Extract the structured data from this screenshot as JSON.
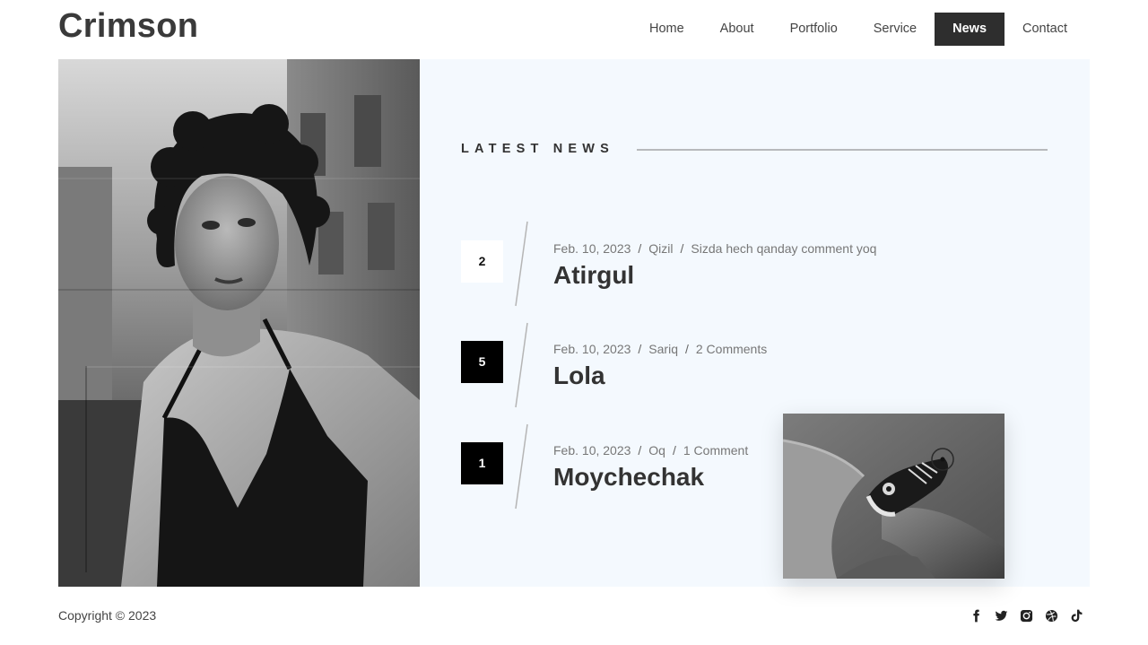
{
  "brand": "Crimson",
  "nav": {
    "items": [
      "Home",
      "About",
      "Portfolio",
      "Service",
      "News",
      "Contact"
    ],
    "active": "News"
  },
  "section": {
    "heading": "LATEST NEWS"
  },
  "news": [
    {
      "number": "2",
      "date": "Feb. 10, 2023",
      "author": "Qizil",
      "comments": "Sizda hech qanday comment yoq",
      "title": "Atirgul",
      "box_style": "light"
    },
    {
      "number": "5",
      "date": "Feb. 10, 2023",
      "author": "Sariq",
      "comments": "2 Comments",
      "title": "Lola",
      "box_style": "dark"
    },
    {
      "number": "1",
      "date": "Feb. 10, 2023",
      "author": "Oq",
      "comments": "1 Comment",
      "title": "Moychechak",
      "box_style": "dark"
    }
  ],
  "meta_separator": "/",
  "footer": {
    "copyright": "Copyright © 2023",
    "socials": [
      "facebook-icon",
      "twitter-icon",
      "instagram-icon",
      "dribbble-icon",
      "tiktok-icon"
    ]
  },
  "colors": {
    "accent_dark": "#2e2e2e",
    "panel_bg": "#f4f9fe",
    "text": "#333333",
    "muted": "#777777"
  }
}
